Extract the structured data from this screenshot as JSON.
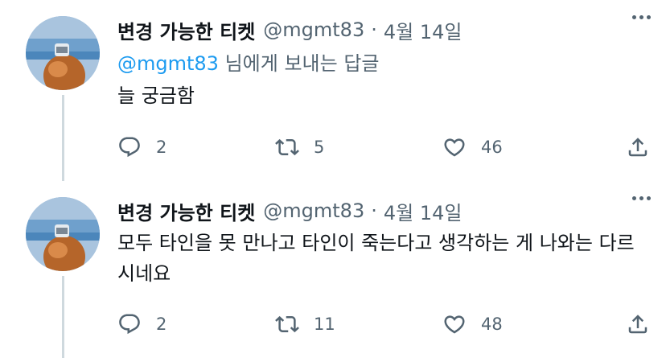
{
  "tweets": [
    {
      "display_name": "변경 가능한 티켓",
      "handle": "@mgmt83",
      "separator": "·",
      "date": "4월 14일",
      "reply_mention": "@mgmt83",
      "reply_suffix": " 님에게 보내는 답글",
      "text": "늘 궁금함",
      "reply_count": "2",
      "retweet_count": "5",
      "like_count": "46"
    },
    {
      "display_name": "변경 가능한 티켓",
      "handle": "@mgmt83",
      "separator": "·",
      "date": "4월 14일",
      "text": "모두 타인을 못 만나고 타인이 죽는다고 생각하는 게 나와는 다르시네요",
      "reply_count": "2",
      "retweet_count": "11",
      "like_count": "48"
    }
  ],
  "icons": {
    "reply": "reply-icon",
    "retweet": "retweet-icon",
    "like": "heart-icon",
    "share": "share-icon",
    "more": "more-icon"
  },
  "colors": {
    "text": "#0f1419",
    "secondary": "#536471",
    "mention": "#1d9bf0",
    "thread_line": "#cfd9de"
  }
}
